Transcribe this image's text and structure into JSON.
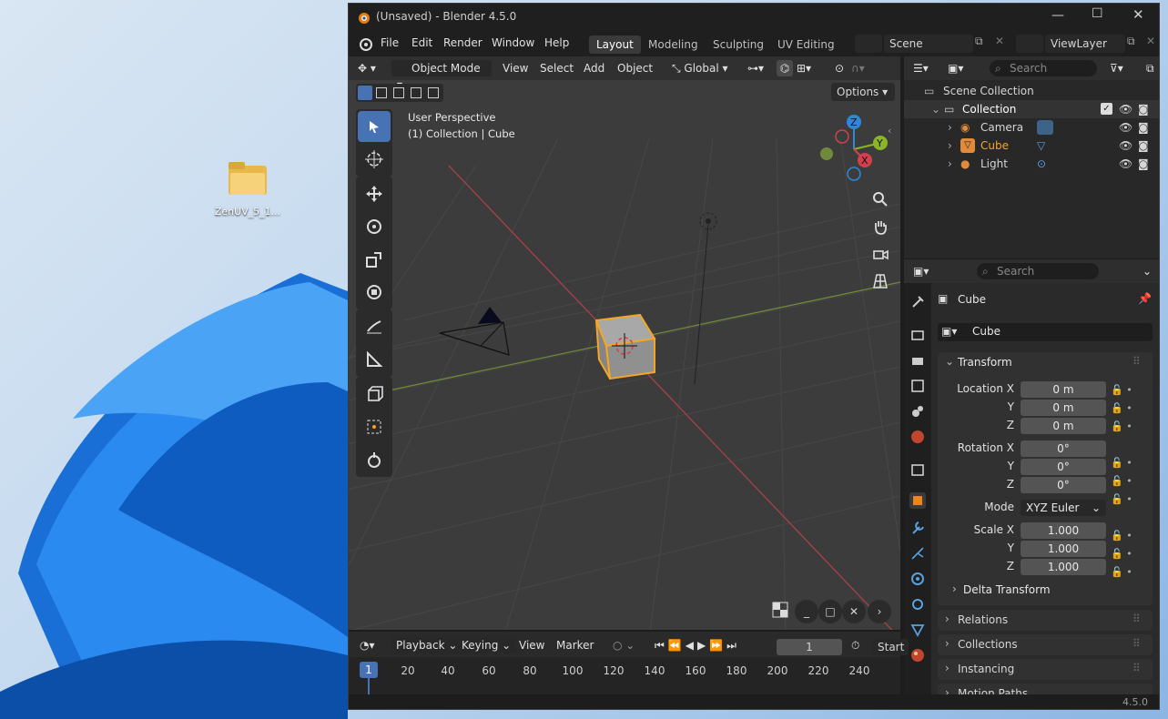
{
  "desktop": {
    "icon_label": "ZenUV_5_1..."
  },
  "window": {
    "title": "(Unsaved) - Blender 4.5.0",
    "menu": [
      "File",
      "Edit",
      "Render",
      "Window",
      "Help"
    ],
    "workspaces": [
      "Layout",
      "Modeling",
      "Sculpting",
      "UV Editing"
    ],
    "active_workspace": "Layout",
    "scene_name": "Scene",
    "view_layer": "ViewLayer"
  },
  "viewport": {
    "mode": "Object Mode",
    "menus": [
      "View",
      "Select",
      "Add",
      "Object"
    ],
    "orientation": "Global",
    "options_label": "Options",
    "overlay_title": "User Perspective",
    "overlay_sub": "(1) Collection | Cube",
    "gizmo": {
      "z": "Z",
      "y": "Y",
      "x": "X"
    }
  },
  "outliner": {
    "search_placeholder": "Search",
    "scene_collection": "Scene Collection",
    "collection": "Collection",
    "items": [
      {
        "label": "Camera",
        "color": "#e3e3e3"
      },
      {
        "label": "Cube",
        "color": "#f5a623"
      },
      {
        "label": "Light",
        "color": "#e3e3e3"
      }
    ]
  },
  "properties": {
    "search_placeholder": "Search",
    "object_name": "Cube",
    "data_name": "Cube",
    "transform_label": "Transform",
    "location": {
      "label": "Location X",
      "x": "0 m",
      "y": "0 m",
      "z": "0 m"
    },
    "rotation": {
      "label": "Rotation X",
      "x": "0°",
      "y": "0°",
      "z": "0°"
    },
    "mode": {
      "label": "Mode",
      "value": "XYZ Euler"
    },
    "scale": {
      "label": "Scale X",
      "x": "1.000",
      "y": "1.000",
      "z": "1.000"
    },
    "axis_y": "Y",
    "axis_z": "Z",
    "delta_transform": "Delta Transform",
    "panels": [
      "Relations",
      "Collections",
      "Instancing",
      "Motion Paths"
    ]
  },
  "timeline": {
    "menus": [
      "Playback",
      "Keying",
      "View",
      "Marker"
    ],
    "current_frame": "1",
    "start_label": "Start",
    "ticks": [
      "20",
      "40",
      "60",
      "80",
      "100",
      "120",
      "140",
      "160",
      "180",
      "200",
      "220",
      "240"
    ],
    "frame_marker": "1"
  },
  "status": {
    "version": "4.5.0"
  },
  "colors": {
    "accent": "#4772b3",
    "selected": "#f5a623",
    "x_axis": "#d2404e",
    "y_axis": "#8bb526",
    "z_axis": "#2f87d8"
  }
}
